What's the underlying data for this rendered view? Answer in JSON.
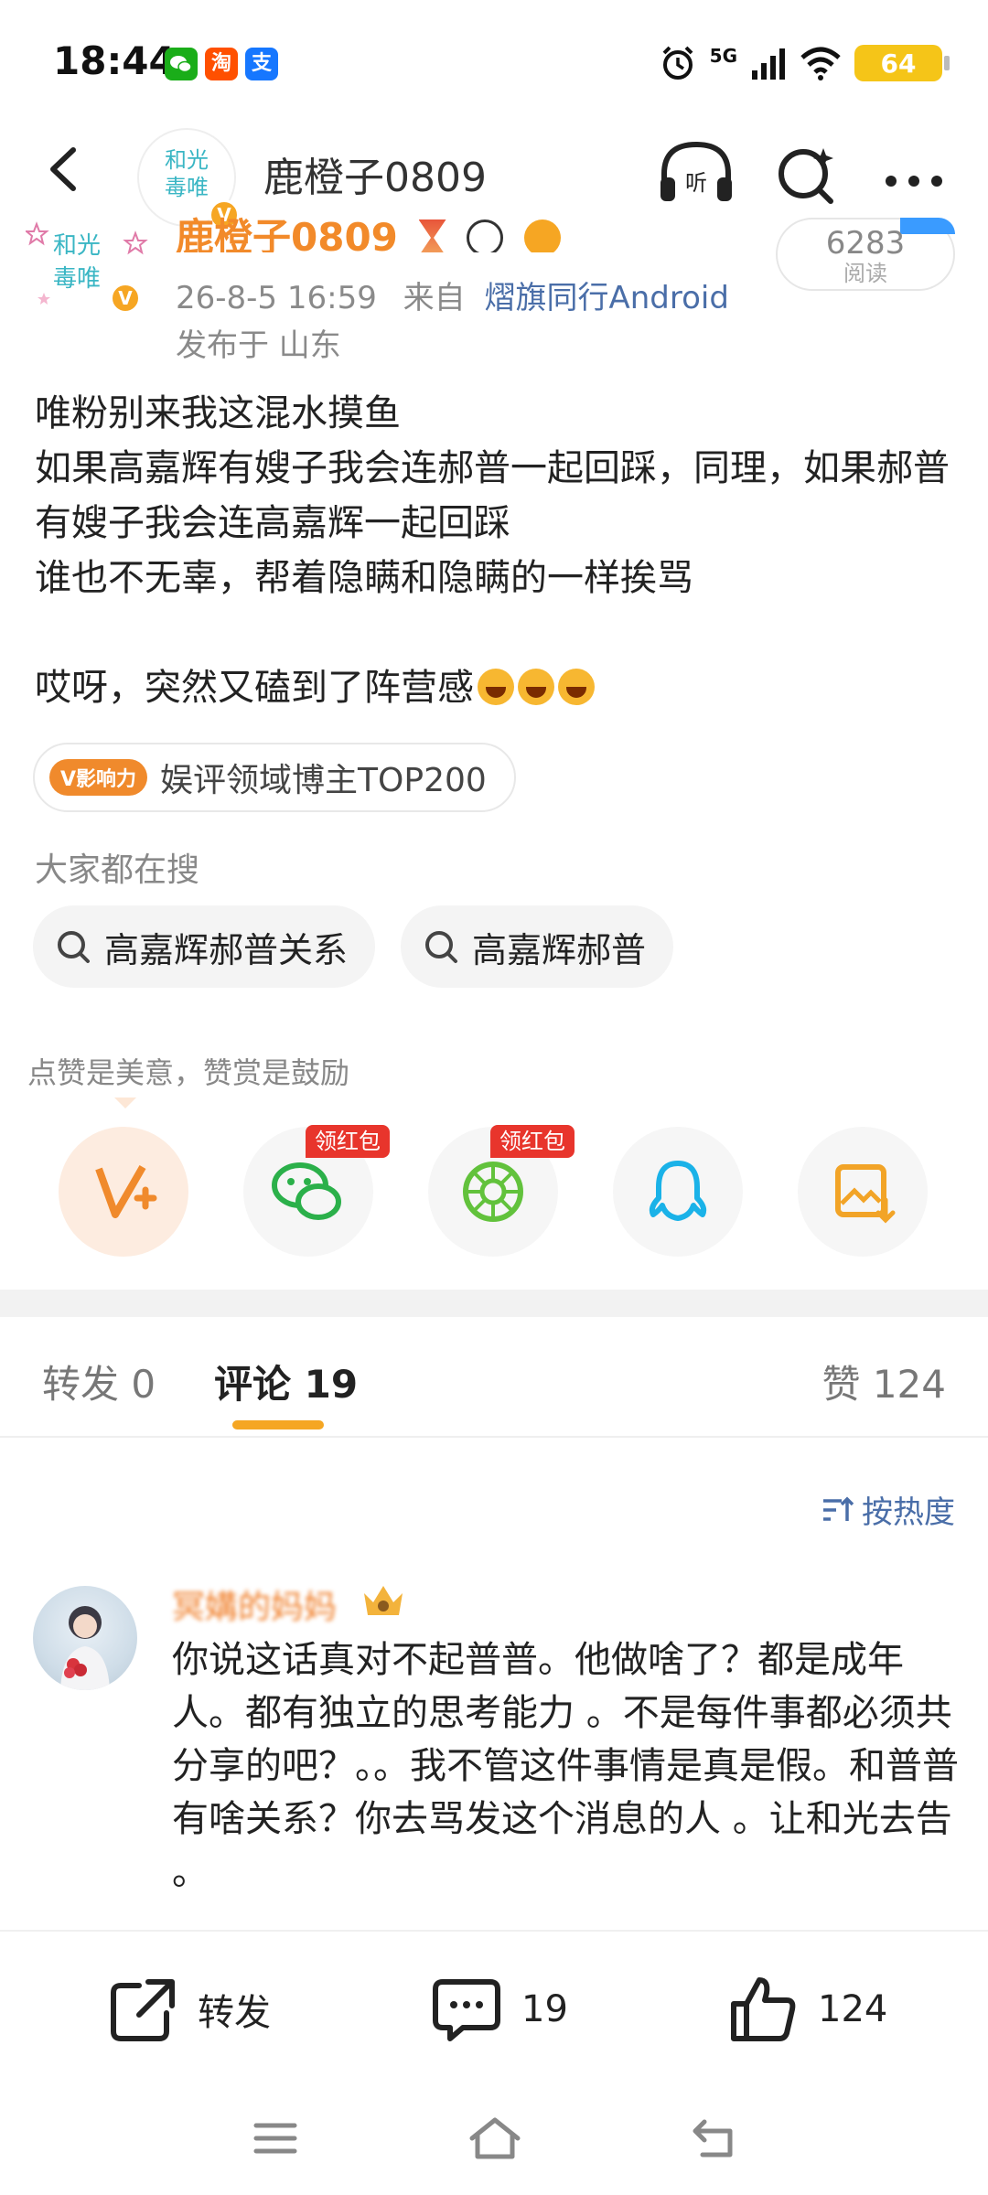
{
  "status_bar": {
    "time": "18:44",
    "app_badges": [
      {
        "name": "wechat",
        "text": "",
        "color": "#1aad19"
      },
      {
        "name": "taobao",
        "text": "淘",
        "color": "#ff5000"
      },
      {
        "name": "alipay",
        "text": "支",
        "color": "#1677ff"
      }
    ],
    "network": "5G",
    "battery": "64"
  },
  "header": {
    "avatar_text": "和光\n毒唯",
    "title": "鹿橙子0809"
  },
  "post": {
    "author": "鹿橙子0809",
    "avatar_text": "和光\n毒唯",
    "time": "26-8-5 16:59",
    "from_label": "来自",
    "source": "熠旗同行Android",
    "location": "发布于 山东",
    "read_count": "6283",
    "read_label": "阅读",
    "lines": [
      "唯粉别来我这混水摸鱼",
      "如果高嘉辉有嫂子我会连郝普一起回踩，同理，如果郝普有嫂子我会连高嘉辉一起回踩",
      "谁也不无辜，帮着隐瞒和隐瞒的一样挨骂",
      "",
      "哎呀，突然又磕到了阵营感"
    ],
    "influence_tag": "V影响力",
    "influence_text": "娱评领域博主TOP200"
  },
  "search": {
    "title": "大家都在搜",
    "chips": [
      "高嘉辉郝普关系",
      "高嘉辉郝普"
    ]
  },
  "reward": {
    "tip": "点赞是美意，赞赏是鼓励",
    "red_packet_label": "领红包",
    "buttons": [
      {
        "name": "reward-v-plus",
        "icon": "v-plus-icon"
      },
      {
        "name": "wechat-share",
        "icon": "wechat-icon"
      },
      {
        "name": "moments-share",
        "icon": "moments-icon"
      },
      {
        "name": "qq-share",
        "icon": "qq-icon"
      },
      {
        "name": "save-image",
        "icon": "save-image-icon"
      }
    ]
  },
  "tabs": {
    "repost": "转发 0",
    "comment": "评论 19",
    "like": "赞 124"
  },
  "sort_label": "按热度",
  "comment": {
    "username": "冥媾的妈妈",
    "text": "你说这话真对不起普普。他做啥了？都是成年人。都有独立的思考能力 。不是每件事都必须共分享的吧？。。我不管这件事情是真是假。和普普有啥关系？你去骂发这个消息的人 。让和光去告 。"
  },
  "bottom_bar": {
    "repost": "转发",
    "comments": "19",
    "likes": "124"
  },
  "colors": {
    "accent_orange": "#f5a623",
    "link_blue": "#4a6ea8",
    "author_orange": "#f28a2a",
    "red_packet": "#e8352c"
  }
}
